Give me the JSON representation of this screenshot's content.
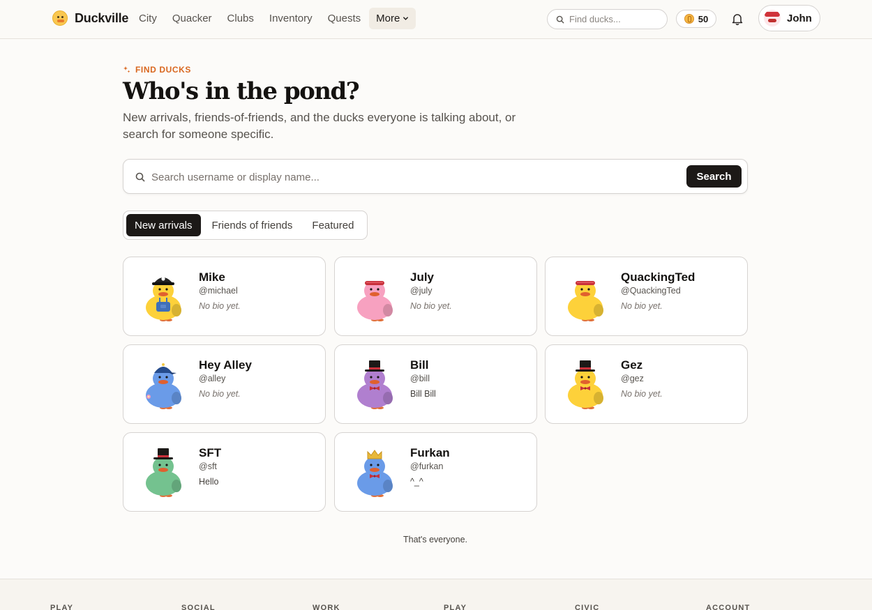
{
  "app": {
    "name": "Duckville"
  },
  "nav": {
    "items": [
      "City",
      "Quacker",
      "Clubs",
      "Inventory",
      "Quests"
    ],
    "more_label": "More"
  },
  "header": {
    "search_placeholder": "Find ducks...",
    "coins": "50",
    "user_name": "John"
  },
  "hero": {
    "eyebrow": "FIND DUCKS",
    "title": "Who's in the pond?",
    "subtitle": "New arrivals, friends-of-friends, and the ducks everyone is talking about, or search for someone specific."
  },
  "search": {
    "placeholder": "Search username or display name...",
    "button_label": "Search"
  },
  "tabs": [
    {
      "label": "New arrivals",
      "active": true
    },
    {
      "label": "Friends of friends",
      "active": false
    },
    {
      "label": "Featured",
      "active": false
    }
  ],
  "ducks": [
    {
      "name": "Mike",
      "handle": "@michael",
      "bio": "No bio yet.",
      "bio_empty": true,
      "color": "#fdd13a",
      "hat": "pirate-hat",
      "accessory": "overalls"
    },
    {
      "name": "July",
      "handle": "@july",
      "bio": "No bio yet.",
      "bio_empty": true,
      "color": "#f7a1c0",
      "hat": "headband",
      "accessory": "none"
    },
    {
      "name": "QuackingTed",
      "handle": "@QuackingTed",
      "bio": "No bio yet.",
      "bio_empty": true,
      "color": "#fdd13a",
      "hat": "headband",
      "accessory": "none"
    },
    {
      "name": "Hey Alley",
      "handle": "@alley",
      "bio": "No bio yet.",
      "bio_empty": true,
      "color": "#6a9be8",
      "hat": "cap",
      "accessory": "flower"
    },
    {
      "name": "Bill",
      "handle": "@bill",
      "bio": "Bill Bill",
      "bio_empty": false,
      "color": "#b07fcf",
      "hat": "top-hat",
      "accessory": "bowtie"
    },
    {
      "name": "Gez",
      "handle": "@gez",
      "bio": "No bio yet.",
      "bio_empty": true,
      "color": "#fdd13a",
      "hat": "top-hat",
      "accessory": "bowtie"
    },
    {
      "name": "SFT",
      "handle": "@sft",
      "bio": "Hello",
      "bio_empty": false,
      "color": "#74c28f",
      "hat": "top-hat",
      "accessory": "none"
    },
    {
      "name": "Furkan",
      "handle": "@furkan",
      "bio": "^_^",
      "bio_empty": false,
      "color": "#6a9be8",
      "hat": "crown",
      "accessory": "bowtie"
    }
  ],
  "end_note": "That's everyone.",
  "footer": {
    "columns": [
      "PLAY",
      "SOCIAL",
      "WORK",
      "PLAY",
      "CIVIC",
      "ACCOUNT"
    ]
  }
}
